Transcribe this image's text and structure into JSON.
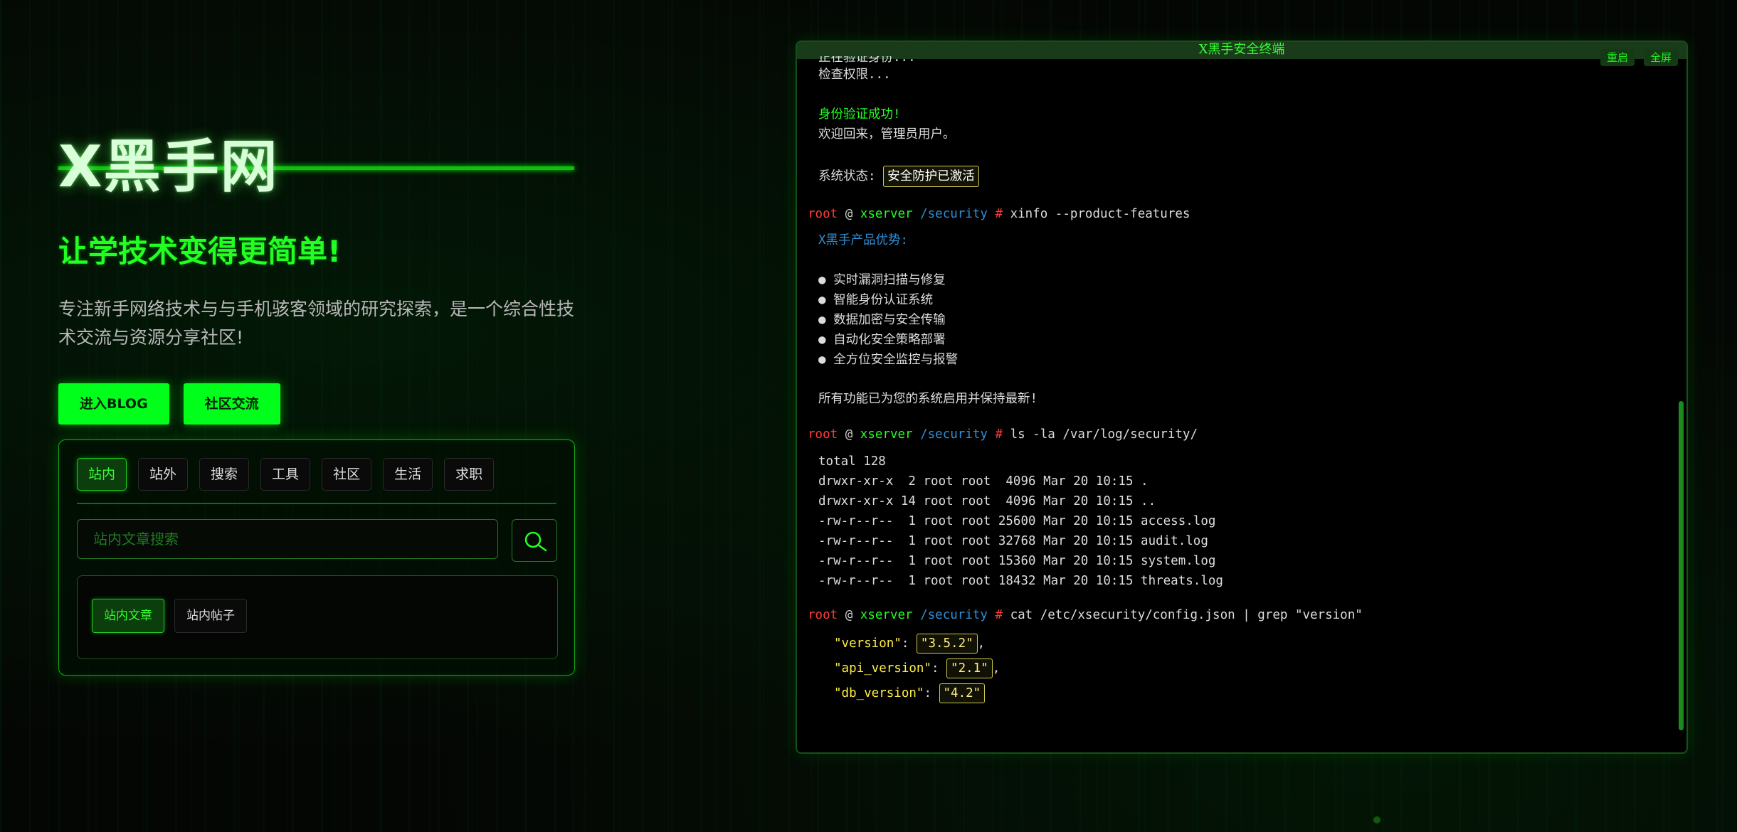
{
  "hero": {
    "site_title": "X黑手网",
    "slogan": "让学技术变得更简单!",
    "description": "专注新手网络技术与与手机骇客领域的研究探索，是一个综合性技术交流与资源分享社区!",
    "btn_blog": "进入BLOG",
    "btn_community": "社区交流"
  },
  "search": {
    "tabs": [
      "站内",
      "站外",
      "搜索",
      "工具",
      "社区",
      "生活",
      "求职"
    ],
    "active_tab": 0,
    "input_placeholder": "站内文章搜索",
    "subtabs": [
      "站内文章",
      "站内帖子"
    ],
    "active_subtab": 0
  },
  "terminal": {
    "title": "X黑手安全终端",
    "btn_restart": "重启",
    "btn_fullscreen": "全屏",
    "line_truncated": "正在验证身份...",
    "line_check": "检查权限...",
    "auth_success": "身份验证成功!",
    "welcome": "欢迎回来，管理员用户。",
    "status_label": "系统状态:",
    "status_badge": "安全防护已激活",
    "prompt": {
      "user": "root",
      "at": "@",
      "host": "xserver",
      "path": "/security",
      "hash": "#"
    },
    "cmd1": "xinfo --product-features",
    "features_title": "X黑手产品优势:",
    "features": [
      "● 实时漏洞扫描与修复",
      "● 智能身份认证系统",
      "● 数据加密与安全传输",
      "● 自动化安全策略部署",
      "● 全方位安全监控与报警"
    ],
    "features_footer": "所有功能已为您的系统启用并保持最新!",
    "cmd2": "ls -la /var/log/security/",
    "ls_output": [
      "total 128",
      "drwxr-xr-x  2 root root  4096 Mar 20 10:15 .",
      "drwxr-xr-x 14 root root  4096 Mar 20 10:15 ..",
      "-rw-r--r--  1 root root 25600 Mar 20 10:15 access.log",
      "-rw-r--r--  1 root root 32768 Mar 20 10:15 audit.log",
      "-rw-r--r--  1 root root 15360 Mar 20 10:15 system.log",
      "-rw-r--r--  1 root root 18432 Mar 20 10:15 threats.log"
    ],
    "cmd3": "cat /etc/xsecurity/config.json | grep \"version\"",
    "json": [
      {
        "key": "\"version\"",
        "value": "\"3.5.2\"",
        "suffix": ","
      },
      {
        "key": "\"api_version\"",
        "value": "\"2.1\"",
        "suffix": ","
      },
      {
        "key": "\"db_version\"",
        "value": "\"4.2\"",
        "suffix": ""
      }
    ]
  }
}
